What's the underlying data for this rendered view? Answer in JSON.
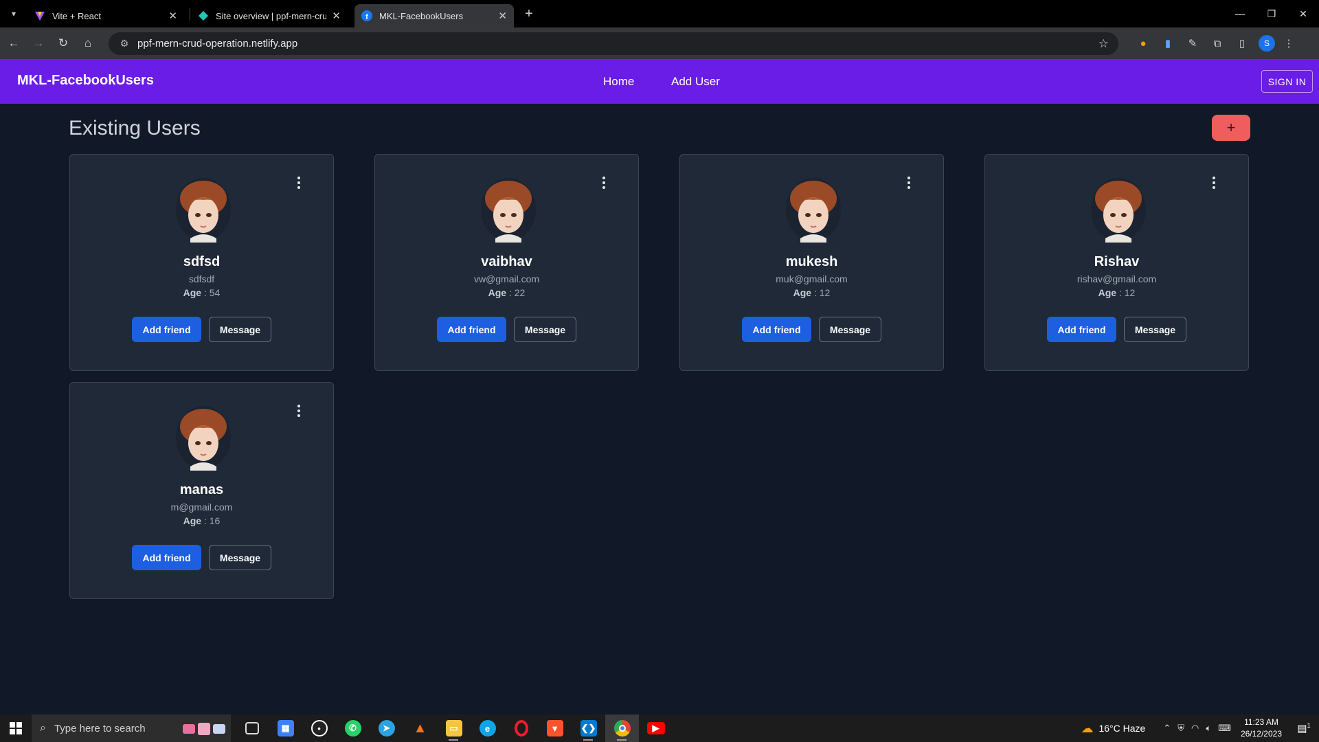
{
  "browser": {
    "tabs": [
      {
        "title": "Vite + React",
        "icon": "vite-icon"
      },
      {
        "title": "Site overview | ppf-mern-crud-",
        "icon": "netlify-icon"
      },
      {
        "title": "MKL-FacebookUsers",
        "icon": "facebook-icon",
        "active": true
      }
    ],
    "url": "ppf-mern-crud-operation.netlify.app",
    "profile_initial": "S"
  },
  "app": {
    "brand": "MKL-FacebookUsers",
    "nav": {
      "home": "Home",
      "add_user": "Add User"
    },
    "signin": "SIGN IN",
    "page_title": "Existing Users",
    "add_button": "+",
    "age_label": "Age",
    "add_friend_label": "Add friend",
    "message_label": "Message",
    "users": [
      {
        "name": "sdfsd",
        "email": "sdfsdf",
        "age": ": 54"
      },
      {
        "name": "vaibhav",
        "email": "vw@gmail.com",
        "age": ": 22"
      },
      {
        "name": "mukesh",
        "email": "muk@gmail.com",
        "age": ": 12"
      },
      {
        "name": "Rishav",
        "email": "rishav@gmail.com",
        "age": ": 12"
      },
      {
        "name": "manas",
        "email": "m@gmail.com",
        "age": ": 16"
      }
    ]
  },
  "taskbar": {
    "search_placeholder": "Type here to search",
    "weather": "16°C  Haze",
    "time": "11:23 AM",
    "date": "26/12/2023",
    "notification_count": "1"
  },
  "colors": {
    "nav_bg": "#6a1de6",
    "page_bg": "#111827",
    "card_bg": "#1f2937",
    "add_friend_bg": "#1d5fe0",
    "fab_bg": "#f05d5e"
  }
}
